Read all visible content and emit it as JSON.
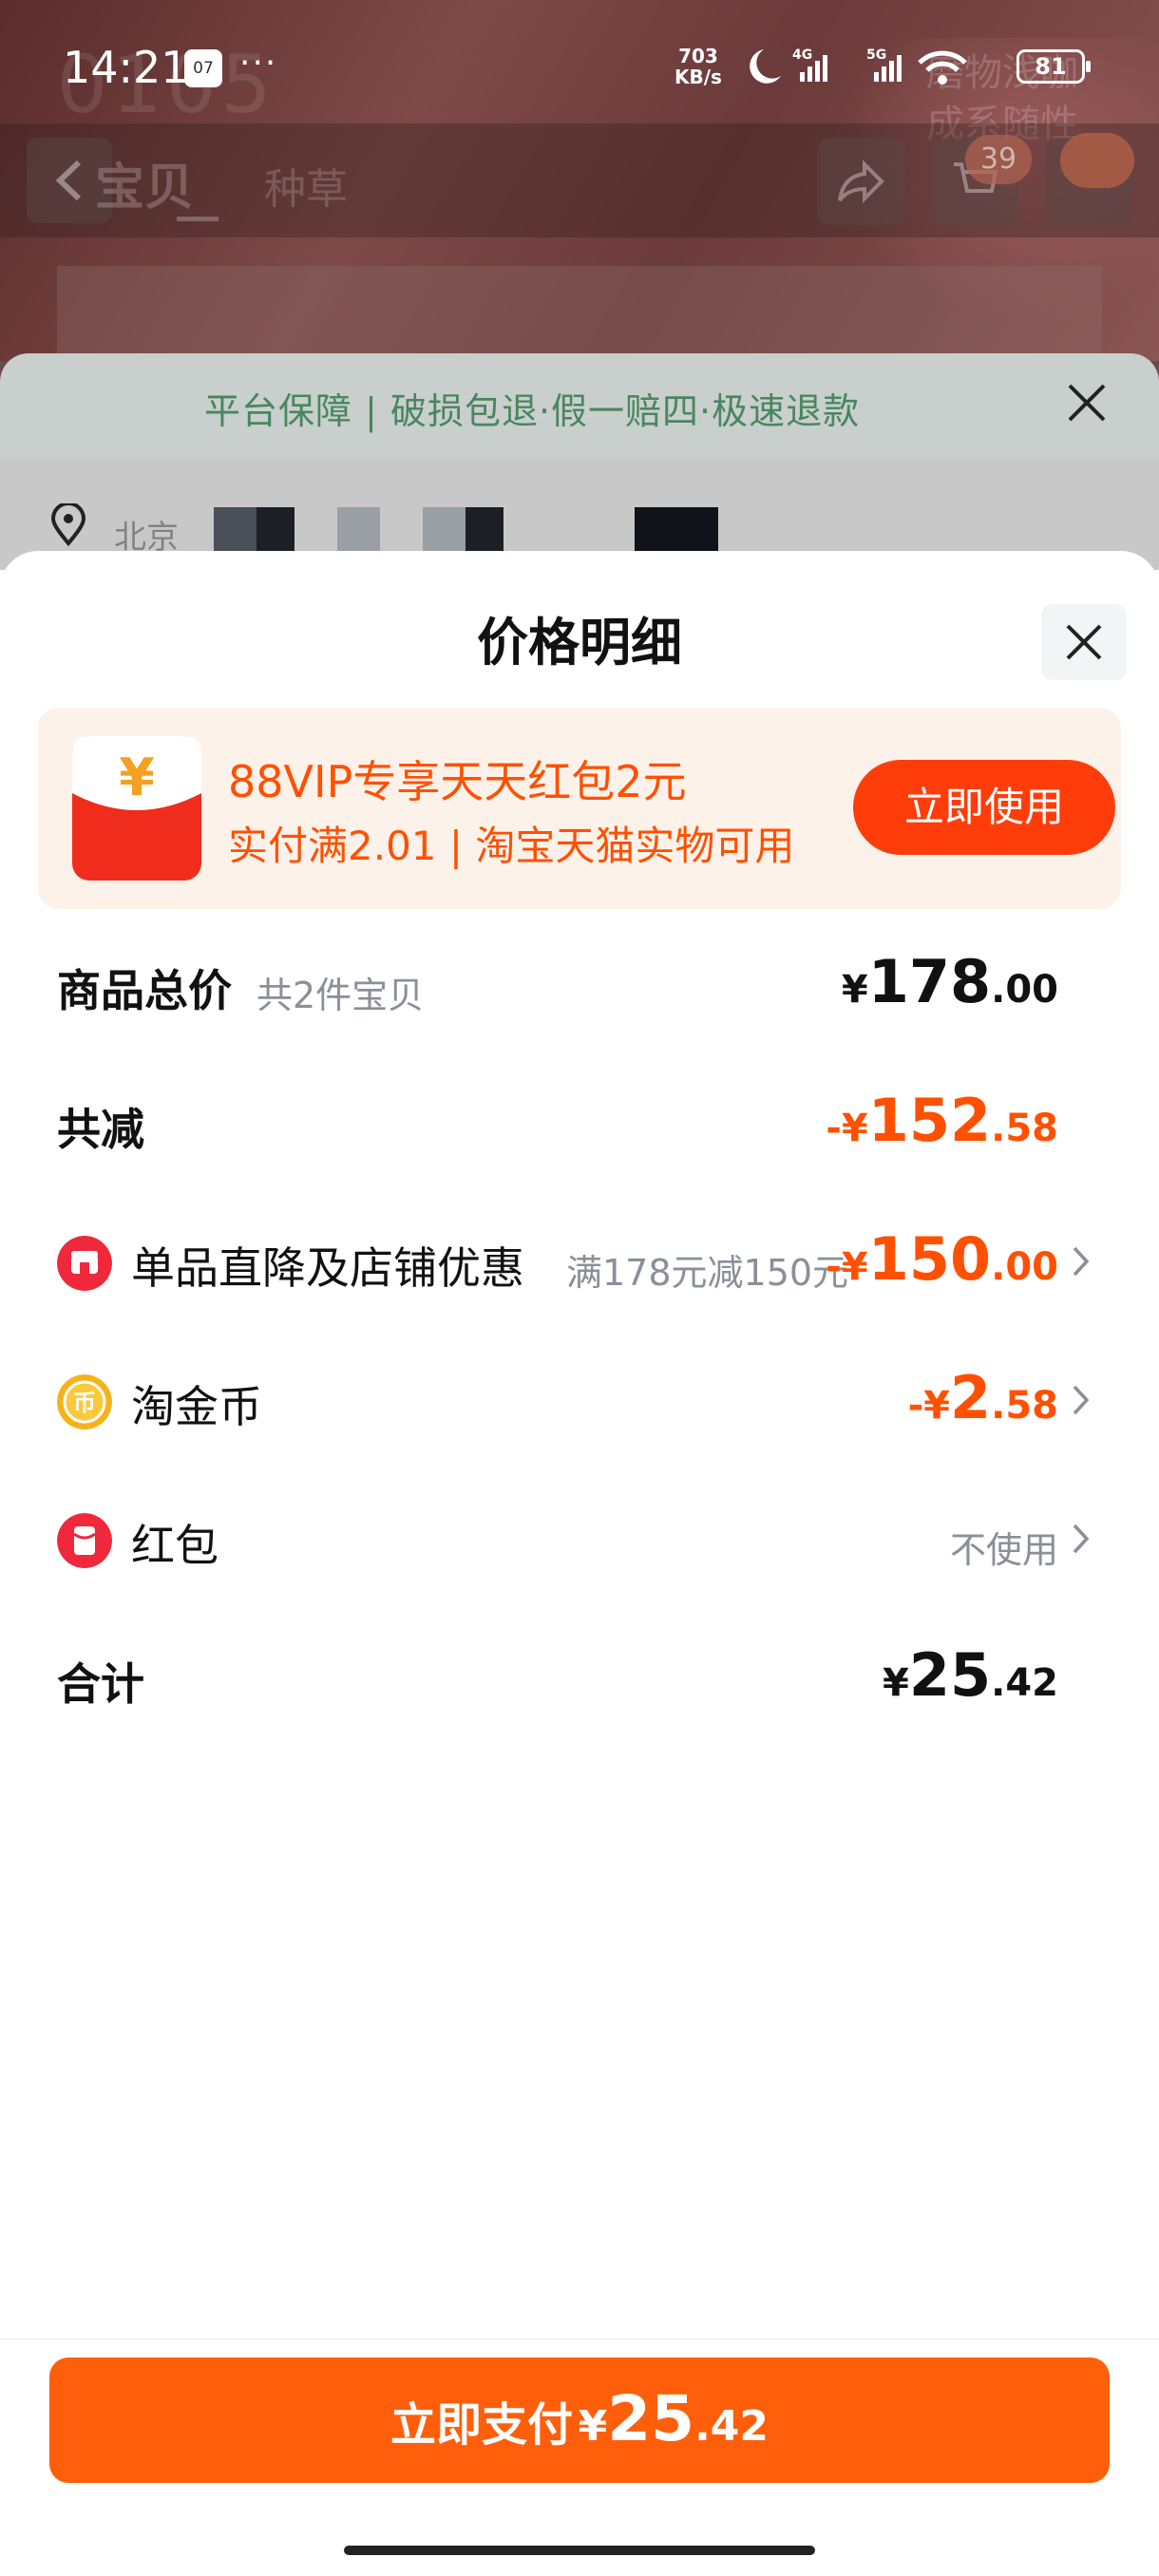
{
  "status_bar": {
    "time": "14:21",
    "calendar_day": "07",
    "more_dots": "···",
    "net_speed_value": "703",
    "net_speed_unit": "KB/s",
    "battery": "81"
  },
  "background": {
    "faint_number": "0105",
    "faint_top_right": "磨物浅咖\n成系随性",
    "tab_left": "宝贝",
    "tab_right": "种草",
    "cart_count": "39",
    "guarantee_text": "平台保障 | 破损包退·假一赔四·极速退款",
    "location_text": "北京"
  },
  "sheet": {
    "title": "价格明细",
    "promo": {
      "title": "88VIP专享天天红包2元",
      "subtitle": "实付满2.01 | 淘宝天猫实物可用",
      "button": "立即使用",
      "icon_glyph": "¥"
    },
    "rows": {
      "total": {
        "label": "商品总价",
        "note": "共2件宝贝",
        "sym": "¥",
        "int": "178",
        "dec": ".00"
      },
      "reduce": {
        "label": "共减",
        "sym": "-¥",
        "int": "152",
        "dec": ".58"
      },
      "discount": {
        "label": "单品直降及店铺优惠",
        "note": "满178元减150元",
        "sym": "-¥",
        "int": "150",
        "dec": ".00"
      },
      "coin": {
        "label": "淘金币",
        "icon_glyph": "币",
        "sym": "-¥",
        "int": "2",
        "dec": ".58"
      },
      "redpacket": {
        "label": "红包",
        "status": "不使用"
      },
      "sum": {
        "label": "合计",
        "sym": "¥",
        "int": "25",
        "dec": ".42"
      }
    },
    "pay_button": {
      "label": "立即支付",
      "sym": "¥",
      "int": "25",
      "dec": ".42"
    }
  },
  "colors": {
    "accent_orange": "#ff5000",
    "pay_button": "#ff5f0a",
    "promo_bg": "#fdf2ea",
    "promo_button": "#ff3d0a",
    "muted_text": "#8a8f99"
  },
  "icons": [
    "back-arrow-icon",
    "share-icon",
    "cart-icon",
    "message-icon",
    "close-icon",
    "location-icon",
    "red-envelope-icon",
    "store-discount-icon",
    "gold-coin-icon",
    "chevron-right-icon",
    "moon-icon",
    "signal-icon",
    "wifi-icon",
    "battery-icon"
  ]
}
